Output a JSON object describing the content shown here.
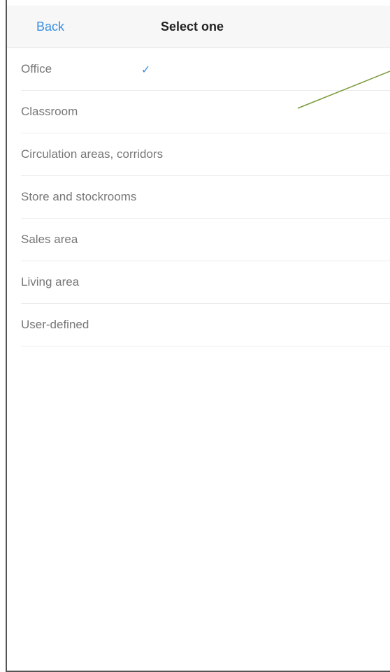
{
  "navbar": {
    "back_label": "Back",
    "title": "Select one"
  },
  "options": {
    "items": [
      {
        "label": "Office",
        "selected": true
      },
      {
        "label": "Classroom",
        "selected": false
      },
      {
        "label": "Circulation areas, corridors",
        "selected": false
      },
      {
        "label": "Store and stockrooms",
        "selected": false
      },
      {
        "label": "Sales area",
        "selected": false
      },
      {
        "label": "Living area",
        "selected": false
      },
      {
        "label": "User-defined",
        "selected": false
      }
    ],
    "checkmark_glyph": "✓"
  },
  "icons": {
    "selected": "checkmark-icon"
  },
  "colors": {
    "accent": "#3b8ee3",
    "annotation": "#7a9a3a"
  }
}
